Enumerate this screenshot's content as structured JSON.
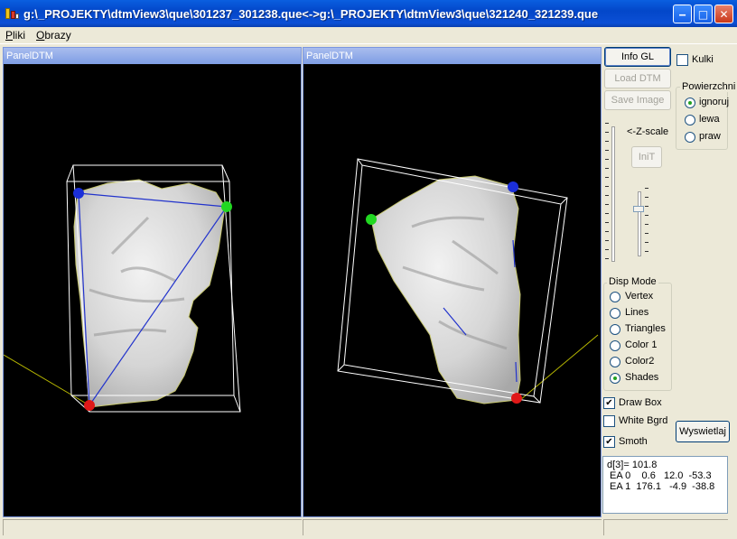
{
  "window": {
    "title": "g:\\_PROJEKTY\\dtmView3\\que\\301237_301238.que<->g:\\_PROJEKTY\\dtmView3\\que\\321240_321239.que",
    "minimize": "‒",
    "maximize": "□",
    "close": "✕"
  },
  "menu": {
    "pliki": {
      "first": "P",
      "rest": "liki"
    },
    "obrazy": {
      "first": "O",
      "rest": "brazy"
    }
  },
  "panels": [
    {
      "title": "PanelDTM"
    },
    {
      "title": "PanelDTM"
    }
  ],
  "controls": {
    "info_gl": "Info GL",
    "load_dtm": "Load DTM",
    "save_image": "Save Image",
    "kulki": "Kulki",
    "kulki_checked": false,
    "powierzchnia": {
      "title": "Powierzchni",
      "options": [
        {
          "label": "ignoruj",
          "selected": true
        },
        {
          "label": "lewa",
          "selected": false
        },
        {
          "label": "praw",
          "selected": false
        }
      ]
    },
    "z_scale_label": "<-Z-scale",
    "init": "IniT",
    "z_scale_level": 0.25,
    "disp_mode": {
      "title": "Disp Mode",
      "options": [
        {
          "label": "Vertex",
          "selected": false
        },
        {
          "label": "Lines",
          "selected": false
        },
        {
          "label": "Triangles",
          "selected": false
        },
        {
          "label": "Color 1",
          "selected": false
        },
        {
          "label": "Color2",
          "selected": false
        },
        {
          "label": "Shades",
          "selected": true
        }
      ]
    },
    "draw_box": {
      "label": "Draw Box",
      "checked": true
    },
    "white_bgrd": {
      "label": "White Bgrd",
      "checked": false
    },
    "smoth": {
      "label": "Smoth",
      "checked": true
    },
    "wyswietlaj": "Wyswietlaj",
    "check_mark": "✔"
  },
  "info": {
    "line1": "d[3]= 101.8",
    "line2": " EA 0    0.6   12.0  -53.3",
    "line3": " EA 1  176.1   -4.9  -38.8"
  },
  "colors": {
    "marker_blue": "#1B2FD9",
    "marker_green": "#22D822",
    "marker_red": "#E01818",
    "line_blue": "#2233CC",
    "axis_yellow": "#B8B800"
  }
}
